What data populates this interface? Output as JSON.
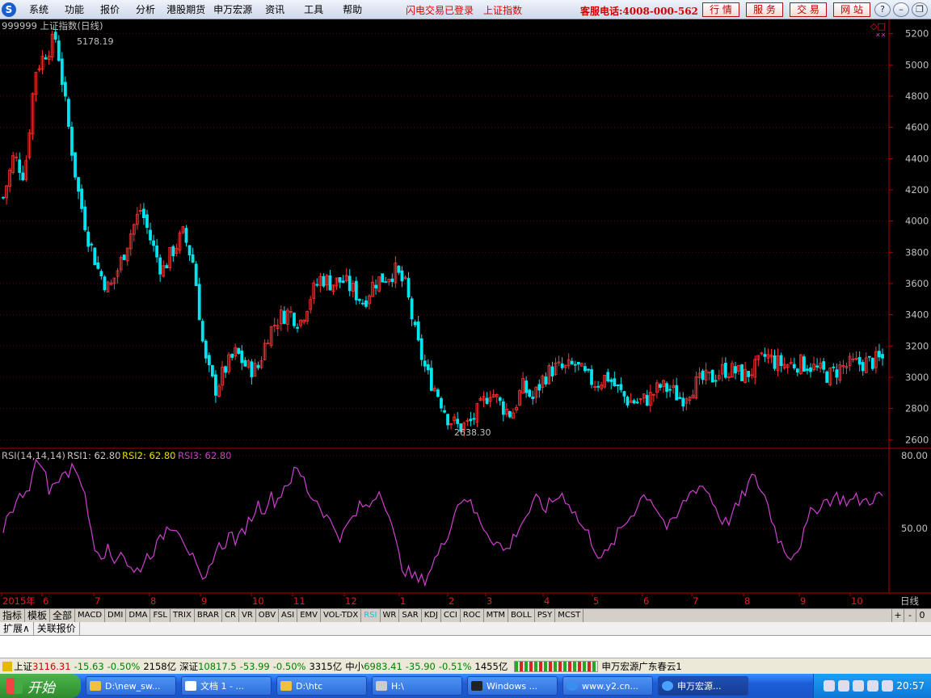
{
  "menu": [
    "系统",
    "功能",
    "报价",
    "分析",
    "港股期货",
    "申万宏源",
    "资讯",
    "工具",
    "帮助"
  ],
  "status_login": "闪电交易已登录",
  "status_index": "上证指数",
  "hotline": "客服电话:4008-000-562",
  "top_buttons": [
    "行 情",
    "服 务",
    "交 易",
    "网 站"
  ],
  "chart_data": [
    {
      "type": "candlestick",
      "title": "999999 上证指数(日线)",
      "y_ticks": [
        "5200",
        "5000",
        "4800",
        "4600",
        "4400",
        "4200",
        "4000",
        "3800",
        "3600",
        "3400",
        "3200",
        "3000",
        "2800",
        "2600"
      ],
      "ylim": [
        2560,
        5250
      ],
      "high_label": "5178.19",
      "low_label": "2638.30",
      "x_labels": [
        "2015年",
        "6",
        "7",
        "8",
        "9",
        "10",
        "11",
        "12",
        "1",
        "2",
        "3",
        "4",
        "5",
        "6",
        "7",
        "8",
        "9",
        "10"
      ],
      "close_path": [
        4150,
        4420,
        4290,
        4960,
        5080,
        5178,
        4680,
        4210,
        3900,
        3680,
        3560,
        3720,
        3920,
        4080,
        3860,
        3680,
        3810,
        3920,
        3720,
        3120,
        2920,
        3060,
        3160,
        3060,
        3050,
        3280,
        3380,
        3420,
        3350,
        3520,
        3640,
        3600,
        3620,
        3560,
        3480,
        3610,
        3640,
        3680,
        3580,
        3240,
        3020,
        2900,
        2740,
        2680,
        2700,
        2800,
        2920,
        2820,
        2760,
        2940,
        2860,
        3000,
        3060,
        3050,
        3080,
        3000,
        2960,
        3010,
        2920,
        2850,
        2840,
        2870,
        2940,
        2920,
        2860,
        2940,
        2980,
        3000,
        3050,
        3040,
        3010,
        3060,
        3140,
        3090,
        3080,
        3090,
        3080,
        3040,
        3010,
        3060,
        3080,
        3090,
        3100,
        3116
      ],
      "color_up": "#ff3232",
      "color_down": "#00e4f0"
    },
    {
      "type": "line",
      "title": "RSI(14,14,14)",
      "legend": [
        {
          "name": "RSI1: 62.80",
          "color": "#d0d0d0"
        },
        {
          "name": "RSI2: 62.80",
          "color": "#e6e600"
        },
        {
          "name": "RSI3: 62.80",
          "color": "#d040d0"
        }
      ],
      "y_ticks": [
        "80.00",
        "50.00"
      ],
      "ylim": [
        24,
        80
      ],
      "values": [
        50,
        58,
        60,
        65,
        68,
        76,
        78,
        65,
        68,
        74,
        72,
        76,
        70,
        56,
        44,
        40,
        41,
        36,
        42,
        36,
        31,
        34,
        38,
        41,
        44,
        50,
        52,
        50,
        44,
        38,
        30,
        26,
        38,
        42,
        44,
        48,
        44,
        50,
        54,
        60,
        58,
        63,
        61,
        67,
        70,
        74,
        71,
        64,
        62,
        58,
        53,
        50,
        46,
        52,
        55,
        60,
        58,
        64,
        66,
        58,
        46,
        36,
        32,
        30,
        28,
        30,
        36,
        40,
        46,
        55,
        61,
        64,
        58,
        54,
        50,
        46,
        44,
        40,
        44,
        50,
        54,
        58,
        62,
        58,
        60,
        63,
        64,
        60,
        55,
        50,
        47,
        41,
        38,
        40,
        46,
        50,
        54,
        58,
        63,
        64,
        60,
        55,
        50,
        52,
        58,
        63,
        66,
        68,
        66,
        61,
        55,
        52,
        56,
        60,
        66,
        71,
        68,
        63,
        54,
        46,
        41,
        39,
        42,
        48,
        56,
        59,
        61,
        62,
        63,
        62,
        61,
        62,
        61,
        62,
        63,
        62.8
      ],
      "color": "#d040d0"
    }
  ],
  "period_label": "日线",
  "indicator_tabs": [
    "指标",
    "模板",
    "全部",
    "MACD",
    "DMI",
    "DMA",
    "FSL",
    "TRIX",
    "BRAR",
    "CR",
    "VR",
    "OBV",
    "ASI",
    "EMV",
    "VOL-TDX",
    "RSI",
    "WR",
    "SAR",
    "KDJ",
    "CCI",
    "ROC",
    "MTM",
    "BOLL",
    "PSY",
    "MCST"
  ],
  "indicator_active": "RSI",
  "tab_ctrls": [
    "+",
    "-",
    "0"
  ],
  "expand_tabs": [
    "扩展∧",
    "关联报价"
  ],
  "statusbar": {
    "sh_label": "上证",
    "sh_val": "3116.31",
    "sh_chg": "-15.63",
    "sh_pct": "-0.50%",
    "sh_amt": "2158亿",
    "sz_label": "深证",
    "sz_val": "10817.5",
    "sz_chg": "-53.99",
    "sz_pct": "-0.50%",
    "sz_amt": "3315亿",
    "zx_label": "中小",
    "zx_val": "6983.41",
    "zx_chg": "-35.90",
    "zx_pct": "-0.51%",
    "zx_amt": "1455亿",
    "server": "申万宏源广东春云1"
  },
  "taskbar": {
    "start": "开始",
    "tasks": [
      "D:\\new_sw...",
      "文档 1 - ...",
      "D:\\htc",
      "H:\\",
      "Windows ...",
      "www.y2.cn...",
      "申万宏源..."
    ],
    "active_task": "申万宏源...",
    "clock": "20:57"
  }
}
